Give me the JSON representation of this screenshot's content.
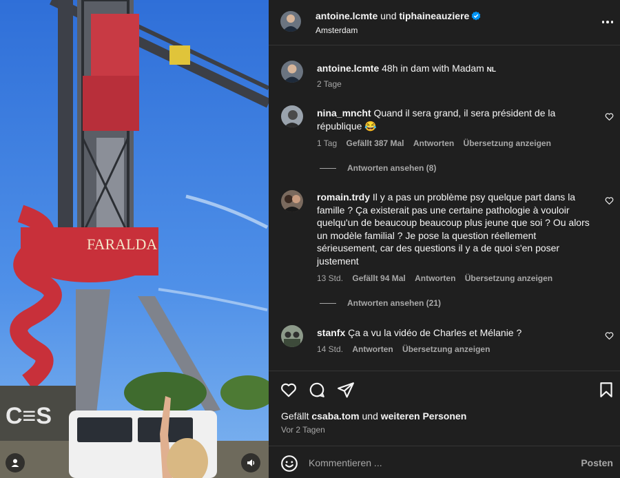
{
  "post": {
    "author": "antoine.lcmte",
    "connector": "und",
    "collaborator": "tiphaineauziere",
    "location": "Amsterdam",
    "caption": {
      "user": "antoine.lcmte",
      "text": "48h in dam with Madam",
      "flag": "NL",
      "time": "2 Tage"
    }
  },
  "photo": {
    "sign_text": "FARALDA"
  },
  "comments": [
    {
      "user": "nina_mncht",
      "text": "Quand il sera grand, il sera président de la république 😂",
      "time": "1 Tag",
      "likes": "Gefällt 387 Mal",
      "reply": "Antworten",
      "translate": "Übersetzung anzeigen",
      "view_replies": "Antworten ansehen (8)"
    },
    {
      "user": "romain.trdy",
      "text": "Il y a pas un problème psy quelque part dans la famille ? Ça existerait pas une certaine pathologie à vouloir quelqu'un de beaucoup beaucoup plus jeune que soi ? Ou alors un modèle familial ? Je pose la question réellement sérieusement, car des questions il y a de quoi s'en poser justement",
      "time": "13 Std.",
      "likes": "Gefällt 94 Mal",
      "reply": "Antworten",
      "translate": "Übersetzung anzeigen",
      "view_replies": "Antworten ansehen (21)"
    },
    {
      "user": "stanfx",
      "text": "Ça a vu la vidéo de Charles et Mélanie ?",
      "time": "14 Std.",
      "reply": "Antworten",
      "translate": "Übersetzung anzeigen"
    }
  ],
  "likes": {
    "prefix": "Gefällt",
    "user": "csaba.tom",
    "middle": "und",
    "suffix": "weiteren Personen"
  },
  "post_date": "Vor 2 Tagen",
  "composer": {
    "placeholder": "Kommentieren ...",
    "post_label": "Posten"
  },
  "icons": [
    "heart-icon",
    "comment-icon",
    "share-icon",
    "bookmark-icon",
    "emoji-icon",
    "more-icon",
    "verified-icon",
    "user-tag-icon",
    "sound-icon"
  ],
  "colors": {
    "panel_bg": "#1f1f1f",
    "text": "#f5f5f5",
    "muted": "#a8a8a8",
    "verified": "#0095f6",
    "divider": "#363636"
  }
}
